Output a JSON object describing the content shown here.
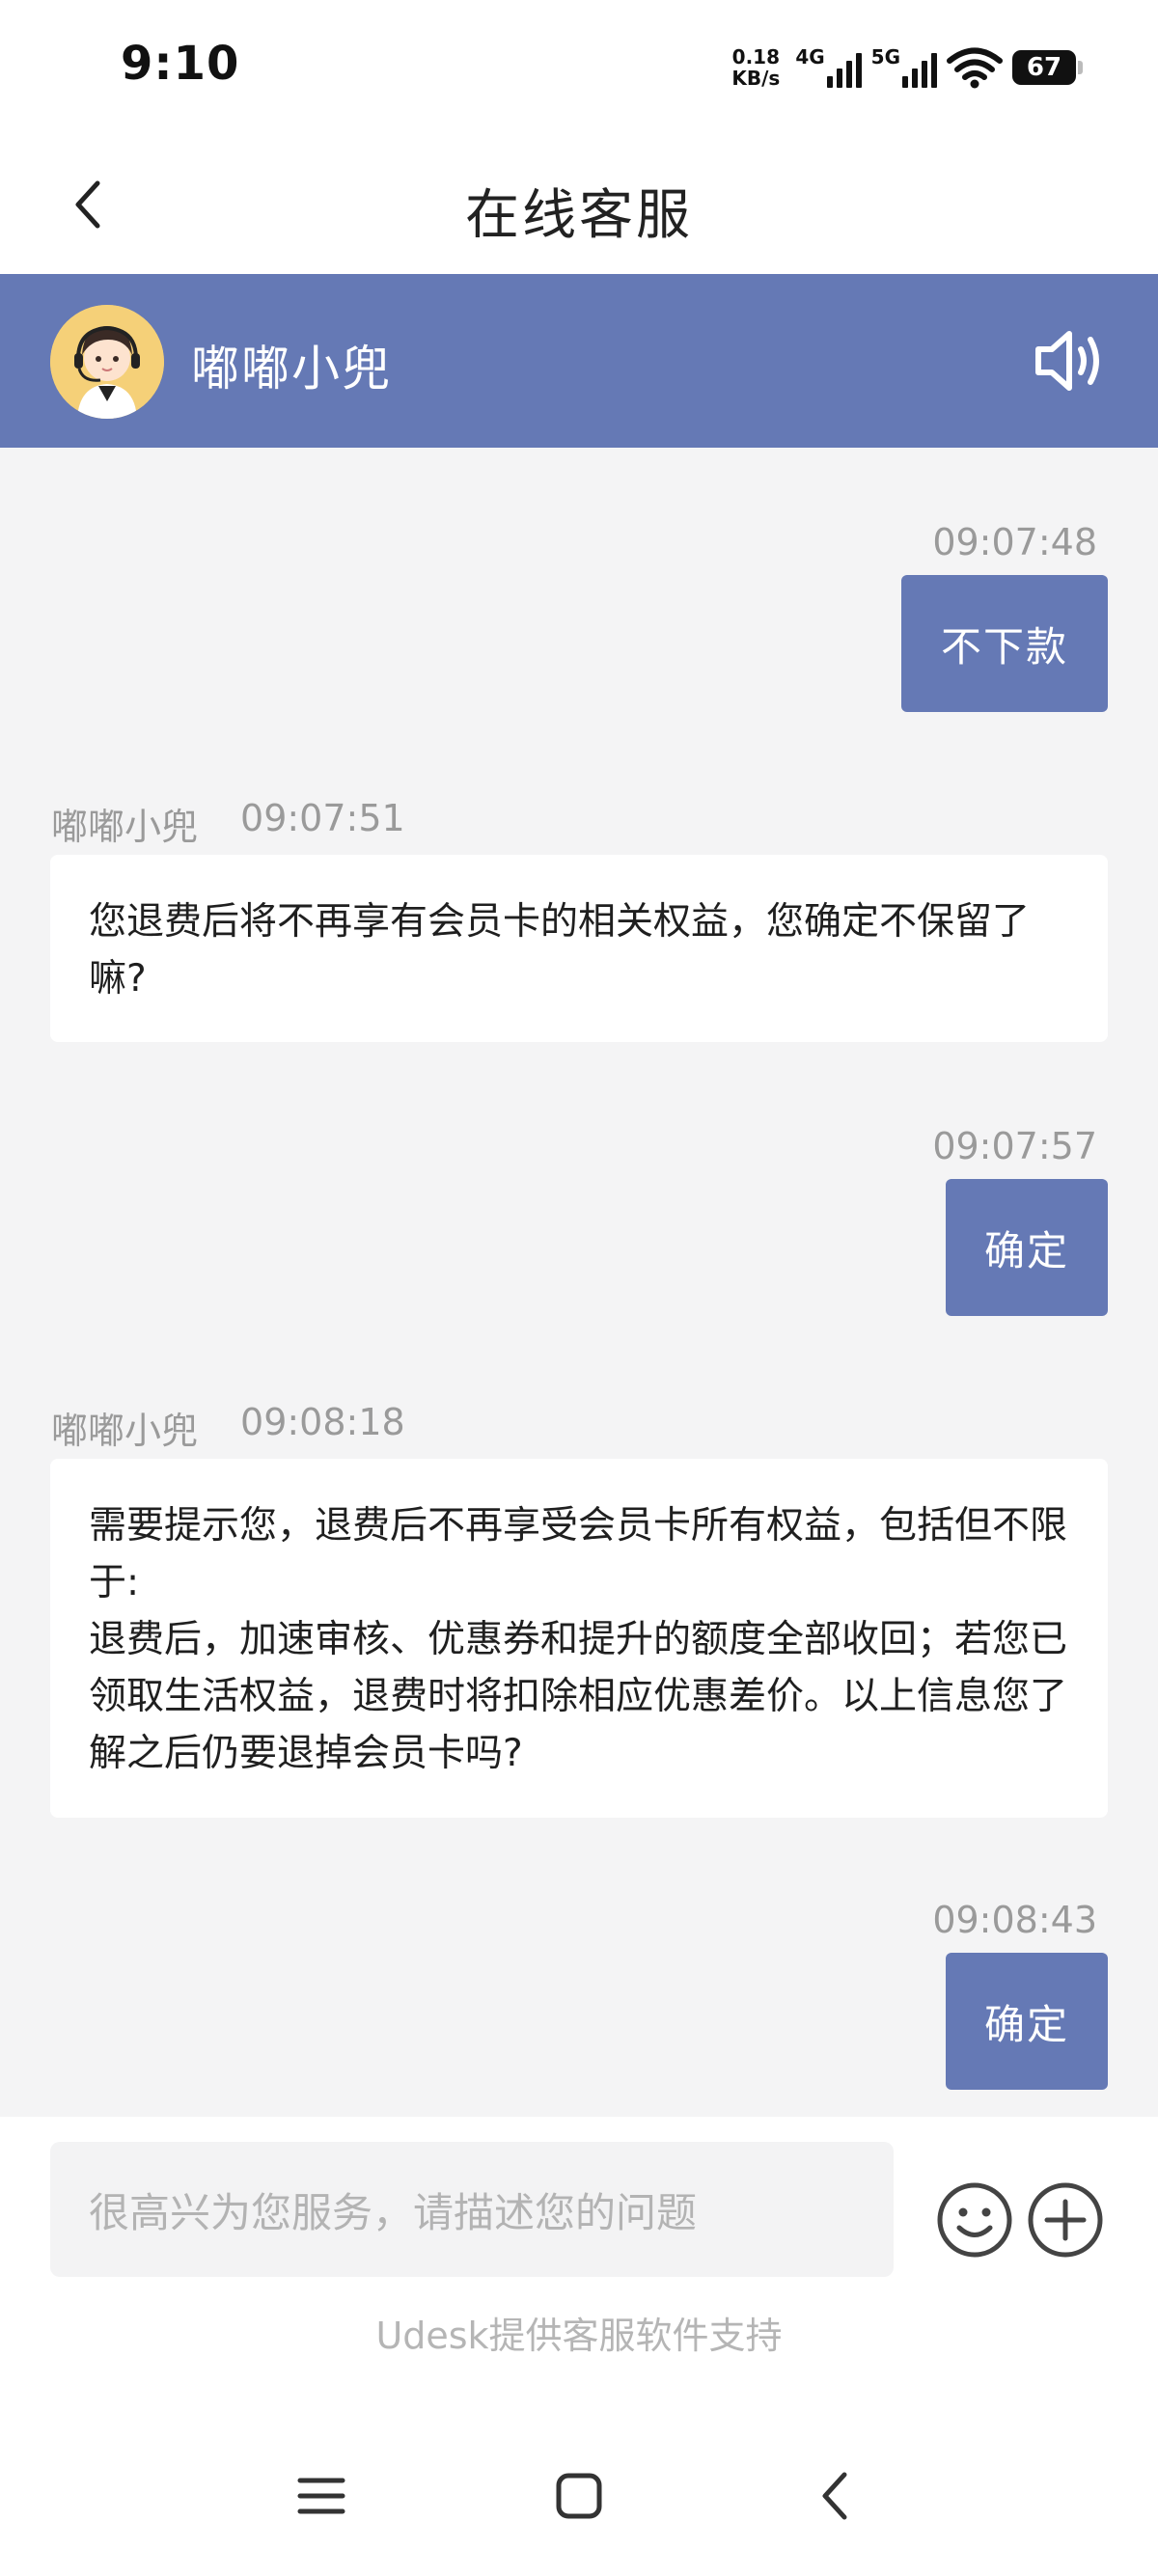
{
  "status_bar": {
    "time": "9:10",
    "net_speed_value": "0.18",
    "net_speed_unit": "KB/s",
    "signal1_label": "4G",
    "signal2_label": "5G",
    "battery_level": "67"
  },
  "nav": {
    "title": "在线客服",
    "back_icon": "chevron-left-icon"
  },
  "agent": {
    "name": "嘟嘟小兜",
    "speaker_icon": "speaker-icon"
  },
  "messages": [
    {
      "direction": "out",
      "time": "09:07:48",
      "text": "不下款"
    },
    {
      "direction": "in",
      "sender": "嘟嘟小兜",
      "time": "09:07:51",
      "text": "您退费后将不再享有会员卡的相关权益，您确定不保留了嘛?"
    },
    {
      "direction": "out",
      "time": "09:07:57",
      "text": "确定"
    },
    {
      "direction": "in",
      "sender": "嘟嘟小兜",
      "time": "09:08:18",
      "lines": [
        "需要提示您，退费后不再享受会员卡所有权益，包括但不限于:",
        "退费后，加速审核、优惠券和提升的额度全部收回；若您已领取生活权益，退费时将扣除相应优惠差价。以上信息您了解之后仍要退掉会员卡吗?"
      ]
    },
    {
      "direction": "out",
      "time": "09:08:43",
      "text": "确定"
    }
  ],
  "input": {
    "placeholder": "很高兴为您服务，请描述您的问题",
    "emoji_icon": "smiley-icon",
    "plus_icon": "plus-circle-icon"
  },
  "footer_note": "Udesk提供客服软件支持",
  "colors": {
    "accent": "#6579b5",
    "background": "#f4f4f5"
  }
}
